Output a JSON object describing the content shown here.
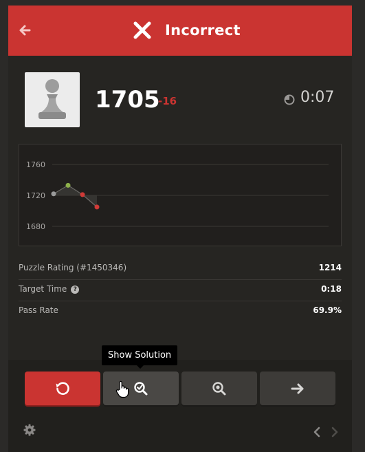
{
  "header": {
    "title": "Incorrect"
  },
  "result": {
    "rating": "1705",
    "delta": "-16",
    "time": "0:07"
  },
  "chart_data": {
    "type": "line",
    "x": [
      0,
      1,
      2,
      3
    ],
    "y": [
      1722,
      1733,
      1721,
      1705
    ],
    "point_colors": [
      "#9a9a9a",
      "#8db04a",
      "#d03a37",
      "#d03a37"
    ],
    "ylim": [
      1660,
      1780
    ],
    "yticks": [
      "1760",
      "1720",
      "1680"
    ],
    "grid": true
  },
  "stats": [
    {
      "label": "Puzzle Rating (#1450346)",
      "value": "1214"
    },
    {
      "label": "Target Time",
      "value": "0:18"
    },
    {
      "label": "Pass Rate",
      "value": "69.9%"
    }
  ],
  "tooltip": {
    "text": "Show Solution"
  },
  "colors": {
    "header": "#ca3431",
    "panel": "#262522",
    "accent_red": "#ca3431"
  },
  "icons": [
    "back-arrow-icon",
    "x-icon",
    "pawn-icon",
    "timer-icon",
    "help-icon",
    "retry-icon",
    "show-solution-icon",
    "analysis-icon",
    "next-arrow-icon",
    "gear-icon",
    "chevron-left-icon",
    "chevron-right-icon",
    "hand-cursor-icon"
  ]
}
